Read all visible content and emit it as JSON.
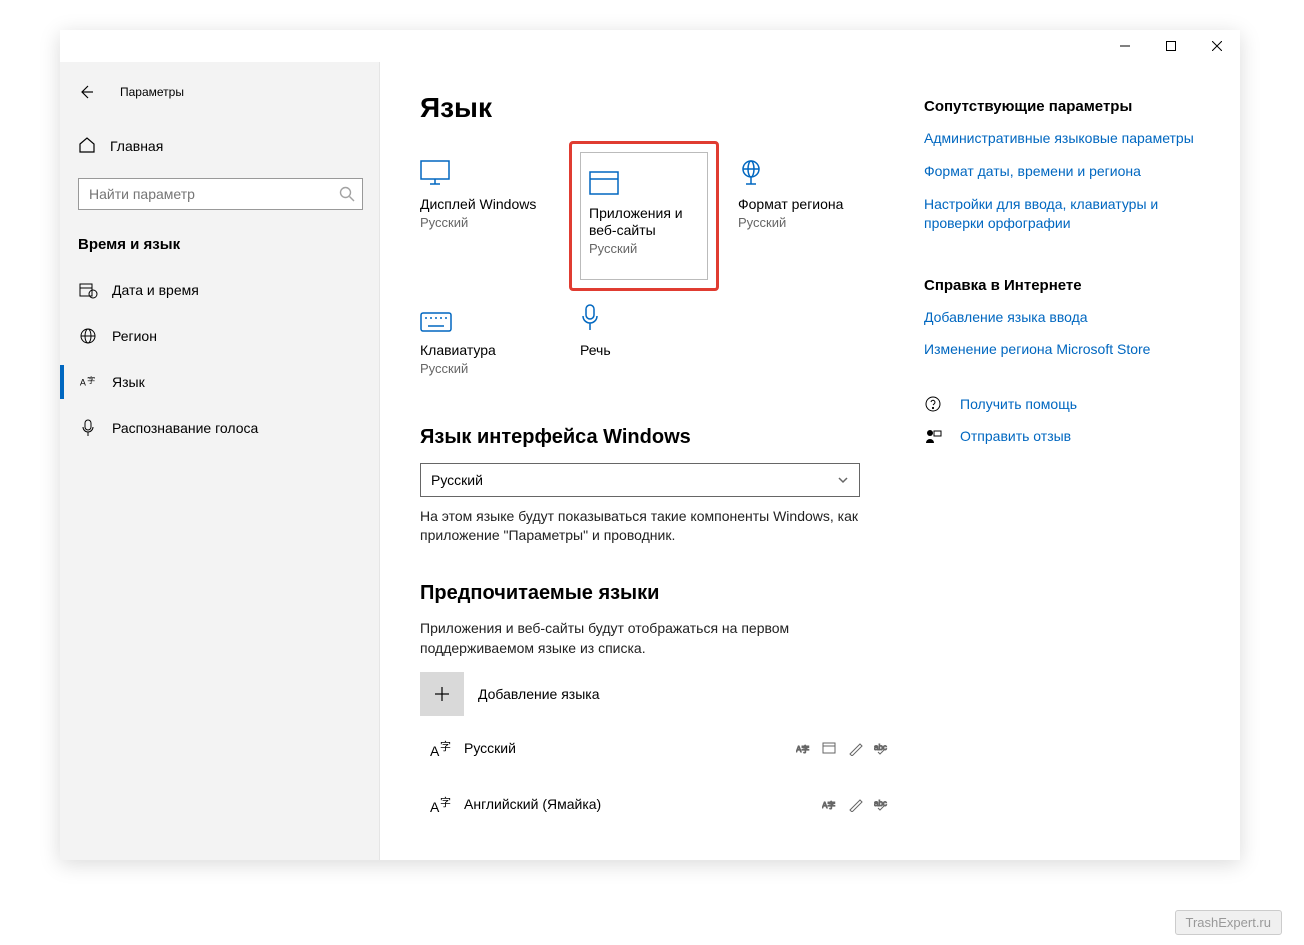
{
  "app_title": "Параметры",
  "home_label": "Главная",
  "search_placeholder": "Найти параметр",
  "section": "Время и язык",
  "nav": [
    {
      "label": "Дата и время"
    },
    {
      "label": "Регион"
    },
    {
      "label": "Язык"
    },
    {
      "label": "Распознавание голоса"
    }
  ],
  "page_title": "Язык",
  "tiles": [
    {
      "title": "Дисплей Windows",
      "sub": "Русский"
    },
    {
      "title": "Приложения и веб-сайты",
      "sub": "Русский"
    },
    {
      "title": "Формат региона",
      "sub": "Русский"
    },
    {
      "title": "Клавиатура",
      "sub": "Русский"
    },
    {
      "title": "Речь",
      "sub": ""
    }
  ],
  "iface": {
    "heading": "Язык интерфейса Windows",
    "value": "Русский",
    "desc": "На этом языке будут показываться такие компоненты Windows, как приложение \"Параметры\" и проводник."
  },
  "pref": {
    "heading": "Предпочитаемые языки",
    "desc": "Приложения и веб-сайты будут отображаться на первом поддерживаемом языке из списка.",
    "add": "Добавление языка",
    "langs": [
      {
        "name": "Русский"
      },
      {
        "name": "Английский (Ямайка)"
      }
    ]
  },
  "aside": {
    "related_head": "Сопутствующие параметры",
    "links": [
      "Административные языковые параметры",
      "Формат даты, времени и региона",
      "Настройки для ввода, клавиатуры и проверки орфографии"
    ],
    "help_head": "Справка в Интернете",
    "help_links": [
      "Добавление языка ввода",
      "Изменение региона Microsoft Store"
    ],
    "get_help": "Получить помощь",
    "feedback": "Отправить отзыв"
  },
  "watermark": "TrashExpert.ru"
}
